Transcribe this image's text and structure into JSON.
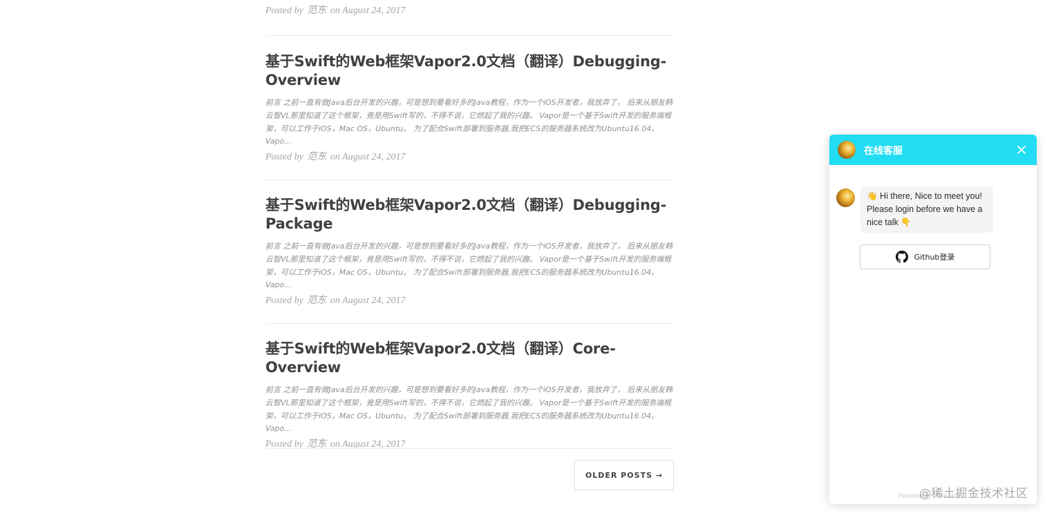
{
  "top_post": {
    "posted_by": "Posted by",
    "author": "范东",
    "on": "on August 24, 2017"
  },
  "posts": [
    {
      "title": "基于Swift的Web框架Vapor2.0文档（翻译）Debugging-Overview",
      "excerpt": "前言 之前一直有做Java后台开发的兴趣，可是想到要看好多的Java教程，作为一个iOS开发者，我放弃了， 后来从朋友韩云智VL那里知道了这个框架，竟是用Swift写的，不得不说，它燃起了我的兴趣。 Vapor是一个基于Swift开发的服务端框架，可以工作于iOS，Mac OS，Ubuntu。 为了配合Swift部署到服务器,我把ECS的服务器系统改为Ubuntu16.04。 Vapo...",
      "posted_by": "Posted by",
      "author": "范东",
      "on": "on August 24, 2017"
    },
    {
      "title": "基于Swift的Web框架Vapor2.0文档（翻译）Debugging-Package",
      "excerpt": "前言 之前一直有做Java后台开发的兴趣，可是想到要看好多的Java教程，作为一个iOS开发者，我放弃了， 后来从朋友韩云智VL那里知道了这个框架，竟是用Swift写的，不得不说，它燃起了我的兴趣。 Vapor是一个基于Swift开发的服务端框架，可以工作于iOS，Mac OS，Ubuntu。 为了配合Swift部署到服务器,我把ECS的服务器系统改为Ubuntu16.04。 Vapo...",
      "posted_by": "Posted by",
      "author": "范东",
      "on": "on August 24, 2017"
    },
    {
      "title": "基于Swift的Web框架Vapor2.0文档（翻译）Core-Overview",
      "excerpt": "前言 之前一直有做Java后台开发的兴趣，可是想到要看好多的Java教程，作为一个iOS开发者，我放弃了， 后来从朋友韩云智VL那里知道了这个框架，竟是用Swift写的，不得不说，它燃起了我的兴趣。 Vapor是一个基于Swift开发的服务端框架，可以工作于iOS，Mac OS，Ubuntu。 为了配合Swift部署到服务器,我把ECS的服务器系统改为Ubuntu16.04。 Vapo...",
      "posted_by": "Posted by",
      "author": "范东",
      "on": "on August 24, 2017"
    }
  ],
  "pager": {
    "older_label": "OLDER POSTS →"
  },
  "chat": {
    "title": "在线客服",
    "message": "👋 Hi there, Nice to meet you! Please login before we have a nice talk 👇",
    "github_login": "Github登录",
    "powered_by": "Powered by Voce.chat",
    "header_color": "#22dcf3",
    "icons": {
      "close": "close-icon",
      "github": "github-icon",
      "avatar": "avatar"
    }
  },
  "watermark": "@稀土掘金技术社区"
}
